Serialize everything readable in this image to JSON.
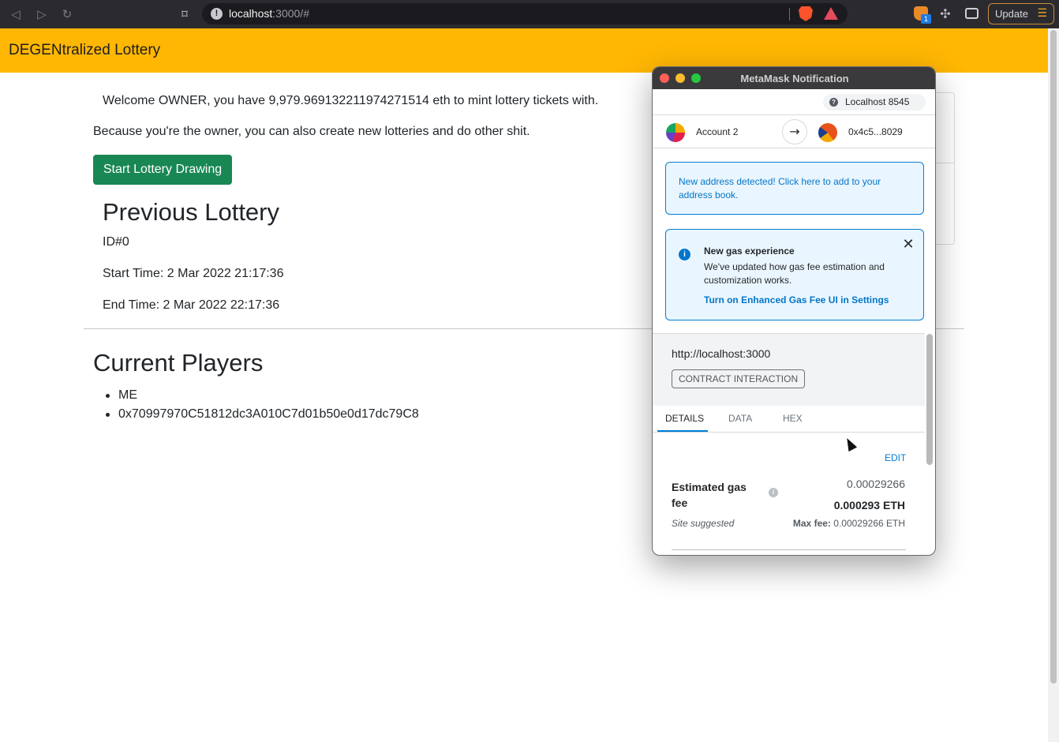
{
  "browser": {
    "url_host": "localhost",
    "url_rest": ":3000/#",
    "update_label": "Update",
    "extension_badge": "1",
    "icons": [
      "back-icon",
      "forward-icon",
      "reload-icon",
      "bookmark-icon",
      "site-info-icon",
      "brave-shields-icon",
      "brave-rewards-icon",
      "metamask-extension-icon",
      "extensions-puzzle-icon",
      "wallet-icon",
      "menu-icon"
    ]
  },
  "app": {
    "title": "DEGENtralized Lottery",
    "welcome": "Welcome OWNER, you have 9,979.969132211974271514 eth to mint lottery tickets with.",
    "owner_note": "Because you're the owner, you can also create new lotteries and do other shit.",
    "start_button": "Start Lottery Drawing",
    "previous_lottery": {
      "heading": "Previous Lottery",
      "id": "ID#0",
      "start_time": "Start Time: 2 Mar 2022 21:17:36",
      "end_time": "End Time: 2 Mar 2022 22:17:36"
    },
    "current_players": {
      "heading": "Current Players",
      "players": [
        "ME",
        "0x70997970C51812dc3A010C7d01b50e0d17dc79C8"
      ]
    }
  },
  "metamask": {
    "window_title": "MetaMask Notification",
    "network": "Localhost 8545",
    "from_account": "Account 2",
    "to_address": "0x4c5...8029",
    "address_alert": "New address detected! Click here to add to your address book.",
    "gas_alert": {
      "title": "New gas experience",
      "body": "We've updated how gas fee estimation and customization works.",
      "link": "Turn on Enhanced Gas Fee UI in Settings"
    },
    "origin": "http://localhost:3000",
    "badge": "CONTRACT INTERACTION",
    "tabs": [
      "DETAILS",
      "DATA",
      "HEX"
    ],
    "edit_label": "EDIT",
    "gas": {
      "label": "Estimated gas fee",
      "secondary": "0.00029266",
      "primary": "0.000293 ETH",
      "site_suggested": "Site suggested",
      "max_fee_label": "Max fee:",
      "max_fee_value": "0.00029266 ETH"
    }
  },
  "colors": {
    "header": "#ffb703",
    "start_button": "#198754",
    "metamask_blue": "#037dd6"
  }
}
